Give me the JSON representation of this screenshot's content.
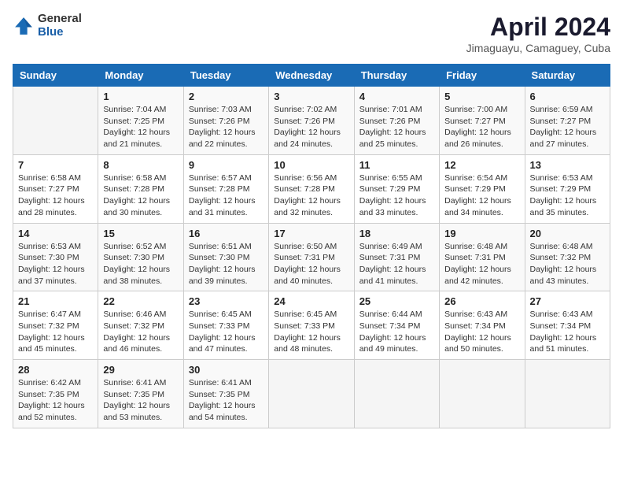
{
  "header": {
    "logo_general": "General",
    "logo_blue": "Blue",
    "title": "April 2024",
    "location": "Jimaguayu, Camaguey, Cuba"
  },
  "weekdays": [
    "Sunday",
    "Monday",
    "Tuesday",
    "Wednesday",
    "Thursday",
    "Friday",
    "Saturday"
  ],
  "weeks": [
    [
      {
        "day": "",
        "sunrise": "",
        "sunset": "",
        "daylight": ""
      },
      {
        "day": "1",
        "sunrise": "Sunrise: 7:04 AM",
        "sunset": "Sunset: 7:25 PM",
        "daylight": "Daylight: 12 hours and 21 minutes."
      },
      {
        "day": "2",
        "sunrise": "Sunrise: 7:03 AM",
        "sunset": "Sunset: 7:26 PM",
        "daylight": "Daylight: 12 hours and 22 minutes."
      },
      {
        "day": "3",
        "sunrise": "Sunrise: 7:02 AM",
        "sunset": "Sunset: 7:26 PM",
        "daylight": "Daylight: 12 hours and 24 minutes."
      },
      {
        "day": "4",
        "sunrise": "Sunrise: 7:01 AM",
        "sunset": "Sunset: 7:26 PM",
        "daylight": "Daylight: 12 hours and 25 minutes."
      },
      {
        "day": "5",
        "sunrise": "Sunrise: 7:00 AM",
        "sunset": "Sunset: 7:27 PM",
        "daylight": "Daylight: 12 hours and 26 minutes."
      },
      {
        "day": "6",
        "sunrise": "Sunrise: 6:59 AM",
        "sunset": "Sunset: 7:27 PM",
        "daylight": "Daylight: 12 hours and 27 minutes."
      }
    ],
    [
      {
        "day": "7",
        "sunrise": "Sunrise: 6:58 AM",
        "sunset": "Sunset: 7:27 PM",
        "daylight": "Daylight: 12 hours and 28 minutes."
      },
      {
        "day": "8",
        "sunrise": "Sunrise: 6:58 AM",
        "sunset": "Sunset: 7:28 PM",
        "daylight": "Daylight: 12 hours and 30 minutes."
      },
      {
        "day": "9",
        "sunrise": "Sunrise: 6:57 AM",
        "sunset": "Sunset: 7:28 PM",
        "daylight": "Daylight: 12 hours and 31 minutes."
      },
      {
        "day": "10",
        "sunrise": "Sunrise: 6:56 AM",
        "sunset": "Sunset: 7:28 PM",
        "daylight": "Daylight: 12 hours and 32 minutes."
      },
      {
        "day": "11",
        "sunrise": "Sunrise: 6:55 AM",
        "sunset": "Sunset: 7:29 PM",
        "daylight": "Daylight: 12 hours and 33 minutes."
      },
      {
        "day": "12",
        "sunrise": "Sunrise: 6:54 AM",
        "sunset": "Sunset: 7:29 PM",
        "daylight": "Daylight: 12 hours and 34 minutes."
      },
      {
        "day": "13",
        "sunrise": "Sunrise: 6:53 AM",
        "sunset": "Sunset: 7:29 PM",
        "daylight": "Daylight: 12 hours and 35 minutes."
      }
    ],
    [
      {
        "day": "14",
        "sunrise": "Sunrise: 6:53 AM",
        "sunset": "Sunset: 7:30 PM",
        "daylight": "Daylight: 12 hours and 37 minutes."
      },
      {
        "day": "15",
        "sunrise": "Sunrise: 6:52 AM",
        "sunset": "Sunset: 7:30 PM",
        "daylight": "Daylight: 12 hours and 38 minutes."
      },
      {
        "day": "16",
        "sunrise": "Sunrise: 6:51 AM",
        "sunset": "Sunset: 7:30 PM",
        "daylight": "Daylight: 12 hours and 39 minutes."
      },
      {
        "day": "17",
        "sunrise": "Sunrise: 6:50 AM",
        "sunset": "Sunset: 7:31 PM",
        "daylight": "Daylight: 12 hours and 40 minutes."
      },
      {
        "day": "18",
        "sunrise": "Sunrise: 6:49 AM",
        "sunset": "Sunset: 7:31 PM",
        "daylight": "Daylight: 12 hours and 41 minutes."
      },
      {
        "day": "19",
        "sunrise": "Sunrise: 6:48 AM",
        "sunset": "Sunset: 7:31 PM",
        "daylight": "Daylight: 12 hours and 42 minutes."
      },
      {
        "day": "20",
        "sunrise": "Sunrise: 6:48 AM",
        "sunset": "Sunset: 7:32 PM",
        "daylight": "Daylight: 12 hours and 43 minutes."
      }
    ],
    [
      {
        "day": "21",
        "sunrise": "Sunrise: 6:47 AM",
        "sunset": "Sunset: 7:32 PM",
        "daylight": "Daylight: 12 hours and 45 minutes."
      },
      {
        "day": "22",
        "sunrise": "Sunrise: 6:46 AM",
        "sunset": "Sunset: 7:32 PM",
        "daylight": "Daylight: 12 hours and 46 minutes."
      },
      {
        "day": "23",
        "sunrise": "Sunrise: 6:45 AM",
        "sunset": "Sunset: 7:33 PM",
        "daylight": "Daylight: 12 hours and 47 minutes."
      },
      {
        "day": "24",
        "sunrise": "Sunrise: 6:45 AM",
        "sunset": "Sunset: 7:33 PM",
        "daylight": "Daylight: 12 hours and 48 minutes."
      },
      {
        "day": "25",
        "sunrise": "Sunrise: 6:44 AM",
        "sunset": "Sunset: 7:34 PM",
        "daylight": "Daylight: 12 hours and 49 minutes."
      },
      {
        "day": "26",
        "sunrise": "Sunrise: 6:43 AM",
        "sunset": "Sunset: 7:34 PM",
        "daylight": "Daylight: 12 hours and 50 minutes."
      },
      {
        "day": "27",
        "sunrise": "Sunrise: 6:43 AM",
        "sunset": "Sunset: 7:34 PM",
        "daylight": "Daylight: 12 hours and 51 minutes."
      }
    ],
    [
      {
        "day": "28",
        "sunrise": "Sunrise: 6:42 AM",
        "sunset": "Sunset: 7:35 PM",
        "daylight": "Daylight: 12 hours and 52 minutes."
      },
      {
        "day": "29",
        "sunrise": "Sunrise: 6:41 AM",
        "sunset": "Sunset: 7:35 PM",
        "daylight": "Daylight: 12 hours and 53 minutes."
      },
      {
        "day": "30",
        "sunrise": "Sunrise: 6:41 AM",
        "sunset": "Sunset: 7:35 PM",
        "daylight": "Daylight: 12 hours and 54 minutes."
      },
      {
        "day": "",
        "sunrise": "",
        "sunset": "",
        "daylight": ""
      },
      {
        "day": "",
        "sunrise": "",
        "sunset": "",
        "daylight": ""
      },
      {
        "day": "",
        "sunrise": "",
        "sunset": "",
        "daylight": ""
      },
      {
        "day": "",
        "sunrise": "",
        "sunset": "",
        "daylight": ""
      }
    ]
  ]
}
